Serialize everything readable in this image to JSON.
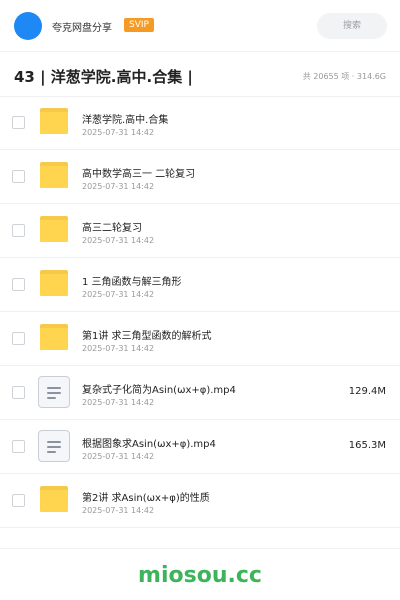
{
  "topbar": {
    "username": "夸克网盘分享",
    "vip_badge": "SVIP",
    "search_label": "搜索",
    "avatar_color": "#1e88f5"
  },
  "header": {
    "title": "43 | 洋葱学院.高中.合集 |",
    "stats": "共 20655 项 · 314.6G"
  },
  "files": [
    {
      "type": "folder",
      "icon": "folder-icon",
      "name": "洋葱学院.高中.合集",
      "date": "2025-07-31 14:42",
      "size": ""
    },
    {
      "type": "folder",
      "icon": "folder-icon",
      "name": "高中数学高三一 二轮复习",
      "date": "2025-07-31 14:42",
      "size": ""
    },
    {
      "type": "folder",
      "icon": "folder-icon",
      "name": "高三二轮复习",
      "date": "2025-07-31 14:42",
      "size": ""
    },
    {
      "type": "folder",
      "icon": "folder-icon",
      "name": "1 三角函数与解三角形",
      "date": "2025-07-31 14:42",
      "size": ""
    },
    {
      "type": "folder",
      "icon": "folder-icon",
      "name": "第1讲 求三角型函数的解析式",
      "date": "2025-07-31 14:42",
      "size": ""
    },
    {
      "type": "file",
      "icon": "file-icon",
      "name": "复杂式子化简为Asin(ωx+φ).mp4",
      "date": "2025-07-31 14:42",
      "size": "129.4M"
    },
    {
      "type": "file",
      "icon": "file-icon",
      "name": "根据图象求Asin(ωx+φ).mp4",
      "date": "2025-07-31 14:42",
      "size": "165.3M"
    },
    {
      "type": "folder",
      "icon": "folder-icon",
      "name": "第2讲 求Asin(ωx+φ)的性质",
      "date": "2025-07-31 14:42",
      "size": ""
    }
  ],
  "footer": {
    "brand": "miosou.cc",
    "brand_color": "#3db35a"
  }
}
